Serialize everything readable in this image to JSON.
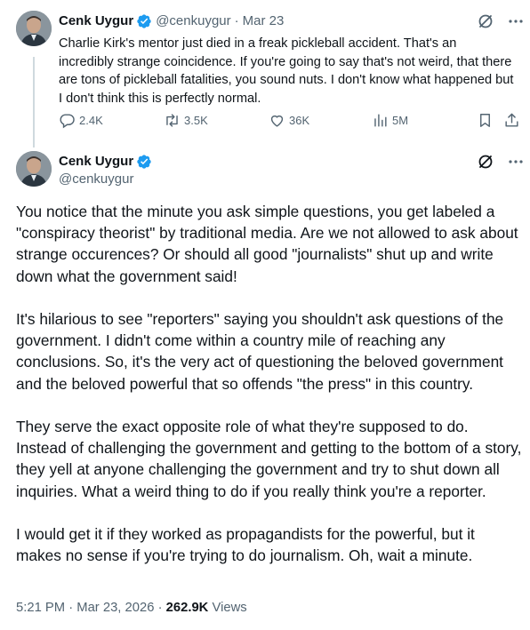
{
  "tweet1": {
    "author_name": "Cenk Uygur",
    "handle": "@cenkuygur",
    "separator": "·",
    "date": "Mar 23",
    "text": "Charlie Kirk's mentor just died in a freak pickleball accident.  That's an incredibly strange coincidence. If you're going to say that's not weird, that there are tons of pickleball fatalities, you sound nuts. I don't know what happened but I don't think this is perfectly normal.",
    "replies": "2.4K",
    "reposts": "3.5K",
    "likes": "36K",
    "views": "5M"
  },
  "tweet2": {
    "author_name": "Cenk Uygur",
    "handle": "@cenkuygur",
    "paragraphs": [
      "You notice that the minute you ask simple questions, you get labeled a \"conspiracy theorist\" by traditional media. Are we not allowed to ask about strange occurences? Or should all good \"journalists\" shut up and write down what the government said!",
      "It's hilarious to see \"reporters\" saying you shouldn't ask questions of the government. I didn't come within a country mile of reaching any conclusions. So, it's the very act of questioning the beloved government and the beloved powerful that so offends \"the press\" in this country.",
      "They serve the exact opposite role of what they're supposed to do. Instead of challenging the government and getting to the bottom of a story, they yell at anyone challenging the government and try to shut down all inquiries. What a weird thing to do if you really think you're a reporter.",
      "I would get it if they worked as propagandists for the powerful, but it makes no sense if you're trying to do journalism. Oh, wait a minute."
    ],
    "timestamp": "5:21 PM · Mar 23, 2026",
    "meta_sep": "·",
    "views_count": "262.9K",
    "views_label": "Views"
  },
  "icons": {
    "verified": "verified-badge-icon",
    "grok": "grok-icon",
    "more": "more-icon",
    "reply": "reply-icon",
    "repost": "repost-icon",
    "like": "like-icon",
    "views": "views-icon",
    "bookmark": "bookmark-icon",
    "share": "share-icon"
  },
  "colors": {
    "verified": "#1d9bf0",
    "secondary_text": "#536471",
    "primary_text": "#0f1419",
    "thread_line": "#cfd9de"
  }
}
